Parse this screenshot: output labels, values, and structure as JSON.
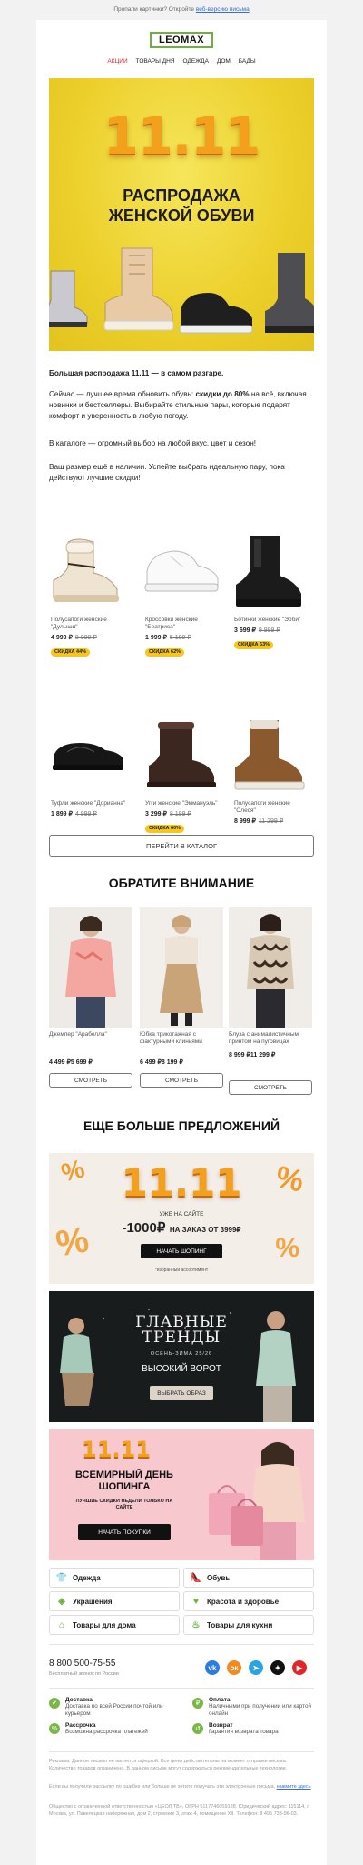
{
  "preheader": {
    "text": "Пропали картинки? Откройте",
    "link": "веб-версию письма"
  },
  "brand": {
    "logo": "LEOMAX",
    "accent": "#6cb33e",
    "sale_red": "#d4282a"
  },
  "nav": [
    "АКЦИИ",
    "ТОВАРЫ ДНЯ",
    "ОДЕЖДА",
    "ДОМ",
    "БАДЫ"
  ],
  "hero": {
    "number": "11.11",
    "title": "РАСПРОДАЖА ЖЕНСКОЙ ОБУВИ"
  },
  "intro": {
    "p1": "Большая распродажа 11.11 — в самом разгаре.",
    "p2_a": "Сейчас — лучшее время обновить обувь: ",
    "p2_b": "скидки до 80%",
    "p2_c": " на всё, включая новинки и бестселлеры. Выбирайте стильные пары, которые подарят комфорт и уверенность в любую погоду.",
    "p3": "В каталоге — огромный выбор на любой вкус, цвет и сезон!",
    "p4": "Ваш размер ещё в наличии. Успейте выбрать идеальную пару, пока действуют лучшие скидки!"
  },
  "products": [
    {
      "name": "Полусапоги женские \"Дулыши\"",
      "price": "4 999 ₽",
      "old": "8 999 ₽",
      "badge": "СКИДКА 44%"
    },
    {
      "name": "Кроссовки женские \"Беатриса\"",
      "price": "1 999 ₽",
      "old": "5 199 ₽",
      "badge": "СКИДКА 62%"
    },
    {
      "name": "Ботинки женские \"Эбби\"",
      "price": "3 699 ₽",
      "old": "9 999 ₽",
      "badge": "СКИДКА 63%"
    },
    {
      "name": "Туфли женские \"Дорианна\"",
      "price": "1 899 ₽",
      "old": "4 999 ₽",
      "badge": ""
    },
    {
      "name": "Угги женские \"Эммануэль\"",
      "price": "3 299 ₽",
      "old": "8 199 ₽",
      "badge": "СКИДКА 60%"
    },
    {
      "name": "Полусапоги женские \"Олеся\"",
      "price": "8 999 ₽",
      "old": "11 299 ₽",
      "badge": ""
    }
  ],
  "catalog_button": "ПЕРЕЙТИ В КАТАЛОГ",
  "attention_title": "ОБРАТИТЕ ВНИМАНИЕ",
  "recommended": [
    {
      "name": "Джемпер \"Арабелла\"",
      "price": "4 499 ₽",
      "old": "5 699 ₽",
      "button": "СМОТРЕТЬ"
    },
    {
      "name": "Юбка трикотажная с фактурными клиньями",
      "price": "6 499 ₽",
      "old": "8 199 ₽",
      "button": "СМОТРЕТЬ"
    },
    {
      "name": "Блуза с анималистичным принтом на пуговицах",
      "price": "8 999 ₽",
      "old": "11 299 ₽",
      "button": "СМОТРЕТЬ"
    }
  ],
  "more_title": "ЕЩЕ БОЛЬШЕ ПРЕДЛОЖЕНИЙ",
  "banners": {
    "b1": {
      "number": "11.11",
      "line": "УЖЕ НА САЙТЕ",
      "discount": "-1000₽",
      "condition": "НА ЗАКАЗ ОТ 3999₽",
      "button": "НАЧАТЬ ШОПИНГ",
      "note": "*избранный ассортимент"
    },
    "b2": {
      "title": "ГЛАВНЫЕ ТРЕНДЫ",
      "season": "ОСЕНЬ-ЗИМА 25/26",
      "subtitle": "ВЫСОКИЙ ВОРОТ",
      "button": "ВЫБРАТЬ ОБРАЗ"
    },
    "b3": {
      "number": "11.11",
      "title": "ВСЕМИРНЫЙ ДЕНЬ ШОПИНГА",
      "sub": "ЛУЧШИЕ СКИДКИ НЕДЕЛИ ТОЛЬКО НА САЙТЕ",
      "button": "НАЧАТЬ ПОКУПКИ"
    }
  },
  "categories": [
    {
      "label": "Одежда",
      "icon": "shirt-icon"
    },
    {
      "label": "Обувь",
      "icon": "shoe-icon"
    },
    {
      "label": "Украшения",
      "icon": "ring-icon"
    },
    {
      "label": "Красота и здоровье",
      "icon": "heart-icon"
    },
    {
      "label": "Товары для дома",
      "icon": "house-icon"
    },
    {
      "label": "Товары для кухни",
      "icon": "pot-icon"
    }
  ],
  "footer": {
    "phone": "8 800 500-75-55",
    "phone_note": "Бесплатный звонок по России",
    "social": [
      {
        "name": "vk",
        "color": "#2d7be0",
        "glyph": "vk"
      },
      {
        "name": "ok",
        "color": "#f28a1e",
        "glyph": "ок"
      },
      {
        "name": "telegram",
        "color": "#2aa3e0",
        "glyph": "➤"
      },
      {
        "name": "zen",
        "color": "#111111",
        "glyph": "✦"
      },
      {
        "name": "youtube",
        "color": "#e0262a",
        "glyph": "▶"
      }
    ],
    "features": [
      {
        "title": "Доставка",
        "desc": "Доставка по всей России почтой или курьером",
        "icon": "truck-icon"
      },
      {
        "title": "Оплата",
        "desc": "Наличными при получении или картой онлайн",
        "icon": "wallet-icon"
      },
      {
        "title": "Рассрочка",
        "desc": "Возможна рассрочка платежей",
        "icon": "percent-icon"
      },
      {
        "title": "Возврат",
        "desc": "Гарантия возврата товара",
        "icon": "return-icon"
      }
    ],
    "legal1": "Реклама. Данное письмо не является офертой. Все цены действительны на момент отправки письма. Количество товаров ограничено. В данном письме могут содержаться рекомендательные технологии.",
    "legal2_a": "Если вы получили рассылку по ошибке или больше не хотите получать эти электронные письма,",
    "legal2_b": "нажмите здесь",
    "legal3": "Общество с ограниченной ответственностью «ЦЕОЛ ТВ», ОГРН 5117746059128. Юридический адрес: 115114, г. Москва, ул. Павелецкая набережная, дом 2, строение 3, этаж 4, помещение XII. Телефон: 8 495 733-96-03."
  }
}
